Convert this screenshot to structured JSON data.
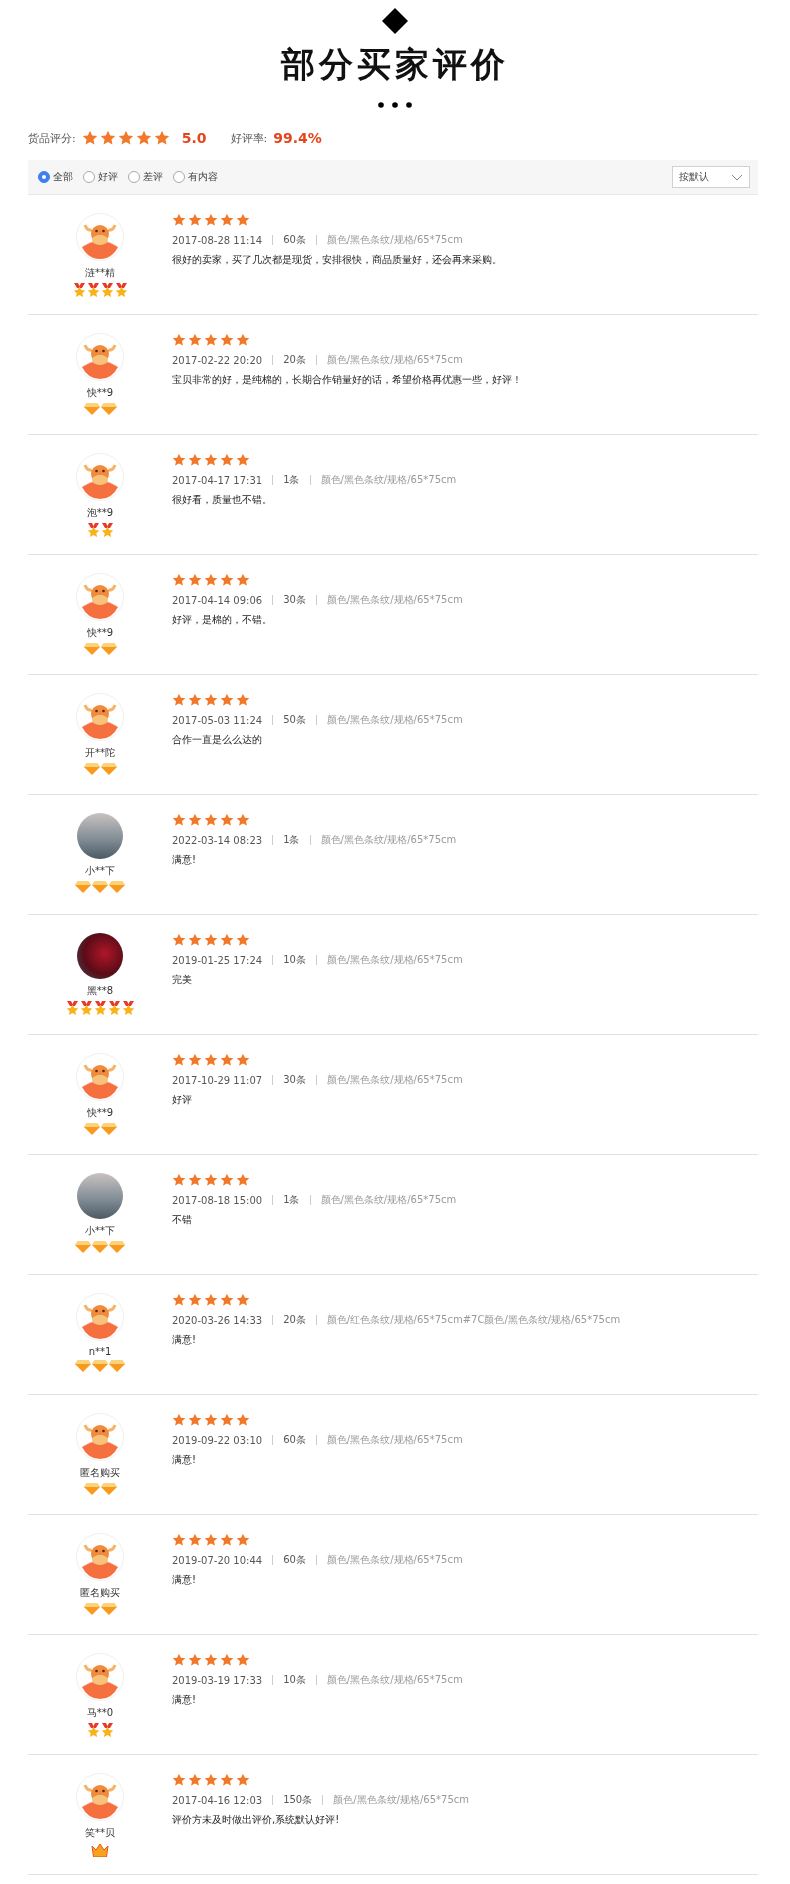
{
  "header": {
    "title": "部分买家评价"
  },
  "summary": {
    "score_label": "货品评分:",
    "stars": 5,
    "score": "5.0",
    "rate_label": "好评率:",
    "rate": "99.4%"
  },
  "filters": [
    {
      "label": "全部",
      "selected": true
    },
    {
      "label": "好评",
      "selected": false
    },
    {
      "label": "差评",
      "selected": false
    },
    {
      "label": "有内容",
      "selected": false
    }
  ],
  "sort": {
    "value": "按默认"
  },
  "reviews": [
    {
      "avatar": {
        "kind": "cow"
      },
      "name": "涟**精",
      "badges": [
        {
          "kind": "medal"
        },
        {
          "kind": "medal"
        },
        {
          "kind": "medal"
        },
        {
          "kind": "medal"
        }
      ],
      "stars": 5,
      "date": "2017-08-28 11:14",
      "quantity": "60条",
      "sku": "颜色/黑色条纹/规格/65*75cm",
      "text": "很好的卖家，买了几次都是现货，安排很快，商品质量好，还会再来采购。"
    },
    {
      "avatar": {
        "kind": "cow"
      },
      "name": "快**9",
      "badges": [
        {
          "kind": "diamond"
        },
        {
          "kind": "diamond"
        }
      ],
      "stars": 5,
      "date": "2017-02-22 20:20",
      "quantity": "20条",
      "sku": "颜色/黑色条纹/规格/65*75cm",
      "text": "宝贝非常的好，是纯棉的，长期合作销量好的话，希望价格再优惠一些，好评！"
    },
    {
      "avatar": {
        "kind": "cow"
      },
      "name": "泡**9",
      "badges": [
        {
          "kind": "medal"
        },
        {
          "kind": "medal"
        }
      ],
      "stars": 5,
      "date": "2017-04-17 17:31",
      "quantity": "1条",
      "sku": "颜色/黑色条纹/规格/65*75cm",
      "text": "很好看，质量也不错。"
    },
    {
      "avatar": {
        "kind": "cow"
      },
      "name": "快**9",
      "badges": [
        {
          "kind": "diamond"
        },
        {
          "kind": "diamond"
        }
      ],
      "stars": 5,
      "date": "2017-04-14 09:06",
      "quantity": "30条",
      "sku": "颜色/黑色条纹/规格/65*75cm",
      "text": "好评，是棉的，不错。"
    },
    {
      "avatar": {
        "kind": "cow"
      },
      "name": "开**陀",
      "badges": [
        {
          "kind": "diamond"
        },
        {
          "kind": "diamond"
        }
      ],
      "stars": 5,
      "date": "2017-05-03 11:24",
      "quantity": "50条",
      "sku": "颜色/黑色条纹/规格/65*75cm",
      "text": "合作一直是么么达的"
    },
    {
      "avatar": {
        "kind": "harbor"
      },
      "name": "小**下",
      "badges": [
        {
          "kind": "diamond"
        },
        {
          "kind": "diamond"
        },
        {
          "kind": "diamond"
        }
      ],
      "stars": 5,
      "date": "2022-03-14 08:23",
      "quantity": "1条",
      "sku": "颜色/黑色条纹/规格/65*75cm",
      "text": "满意!"
    },
    {
      "avatar": {
        "kind": "berries"
      },
      "name": "黑**8",
      "badges": [
        {
          "kind": "medal"
        },
        {
          "kind": "medal"
        },
        {
          "kind": "medal"
        },
        {
          "kind": "medal"
        },
        {
          "kind": "medal"
        }
      ],
      "stars": 5,
      "date": "2019-01-25 17:24",
      "quantity": "10条",
      "sku": "颜色/黑色条纹/规格/65*75cm",
      "text": "完美"
    },
    {
      "avatar": {
        "kind": "cow"
      },
      "name": "快**9",
      "badges": [
        {
          "kind": "diamond"
        },
        {
          "kind": "diamond"
        }
      ],
      "stars": 5,
      "date": "2017-10-29 11:07",
      "quantity": "30条",
      "sku": "颜色/黑色条纹/规格/65*75cm",
      "text": "好评"
    },
    {
      "avatar": {
        "kind": "harbor"
      },
      "name": "小**下",
      "badges": [
        {
          "kind": "diamond"
        },
        {
          "kind": "diamond"
        },
        {
          "kind": "diamond"
        }
      ],
      "stars": 5,
      "date": "2017-08-18 15:00",
      "quantity": "1条",
      "sku": "颜色/黑色条纹/规格/65*75cm",
      "text": "不错"
    },
    {
      "avatar": {
        "kind": "cow"
      },
      "name": "n**1",
      "badges": [
        {
          "kind": "diamond"
        },
        {
          "kind": "diamond"
        },
        {
          "kind": "diamond"
        }
      ],
      "stars": 5,
      "date": "2020-03-26 14:33",
      "quantity": "20条",
      "sku": "颜色/红色条纹/规格/65*75cm#7C颜色/黑色条纹/规格/65*75cm",
      "text": "满意!"
    },
    {
      "avatar": {
        "kind": "cow"
      },
      "name": "匿名购买",
      "badges": [
        {
          "kind": "diamond"
        },
        {
          "kind": "diamond"
        }
      ],
      "stars": 5,
      "date": "2019-09-22 03:10",
      "quantity": "60条",
      "sku": "颜色/黑色条纹/规格/65*75cm",
      "text": "满意!"
    },
    {
      "avatar": {
        "kind": "cow"
      },
      "name": "匿名购买",
      "badges": [
        {
          "kind": "diamond"
        },
        {
          "kind": "diamond"
        }
      ],
      "stars": 5,
      "date": "2019-07-20 10:44",
      "quantity": "60条",
      "sku": "颜色/黑色条纹/规格/65*75cm",
      "text": "满意!"
    },
    {
      "avatar": {
        "kind": "cow"
      },
      "name": "马**0",
      "badges": [
        {
          "kind": "medal"
        },
        {
          "kind": "medal"
        }
      ],
      "stars": 5,
      "date": "2019-03-19 17:33",
      "quantity": "10条",
      "sku": "颜色/黑色条纹/规格/65*75cm",
      "text": "满意!"
    },
    {
      "avatar": {
        "kind": "cow"
      },
      "name": "笑**贝",
      "badges": [
        {
          "kind": "crown"
        }
      ],
      "stars": 5,
      "date": "2017-04-16 12:03",
      "quantity": "150条",
      "sku": "颜色/黑色条纹/规格/65*75cm",
      "text": "评价方未及时做出评价,系统默认好评!"
    }
  ]
}
